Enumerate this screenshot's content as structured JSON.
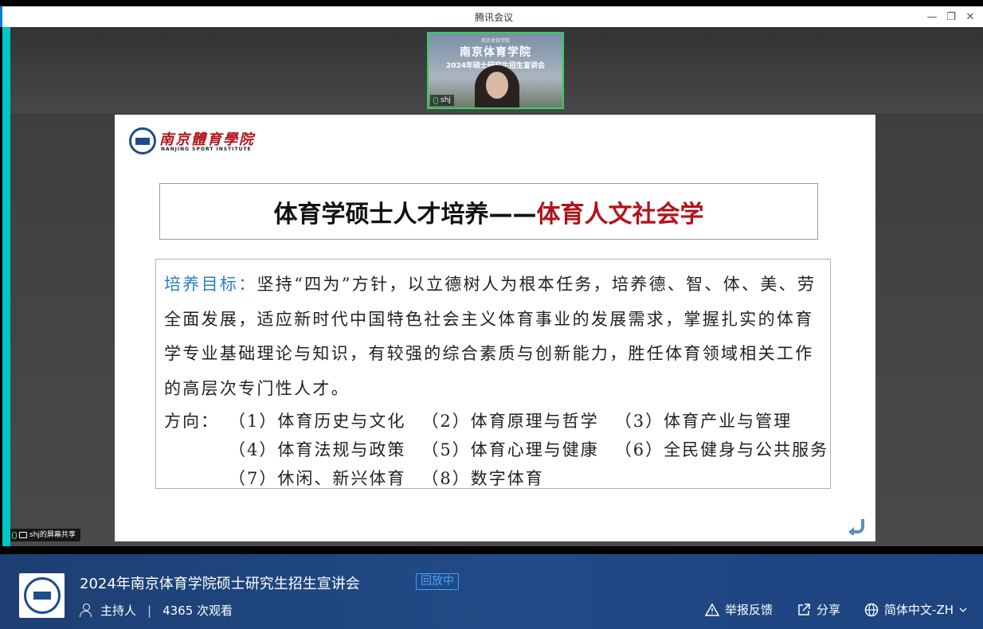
{
  "window": {
    "title": "腾讯会议",
    "controls": {
      "minimize": "—",
      "restore": "❐",
      "close": "✕"
    }
  },
  "video": {
    "banner_small": "南京体育学院",
    "banner_title": "南京体育学院",
    "banner_subtitle": "2024年硕士研究生招生宣讲会",
    "participant_name": "shj"
  },
  "slide": {
    "logo_cn": "南京體育學院",
    "logo_en": "NANJING SPORT INSTITUTE",
    "heading_black": "体育学硕士人才培养——",
    "heading_red": "体育人文社会学",
    "goal_label": "培养目标：",
    "goal_text": "坚持“四为”方针，以立德树人为根本任务，培养德、智、体、美、劳全面发展，适应新时代中国特色社会主义体育事业的发展需求，掌握扎实的体育学专业基础理论与知识，有较强的综合素质与创新能力，胜任体育领域相关工作的高层次专门性人才。",
    "direction_label": "方向：",
    "directions": [
      "（1）体育历史与文化",
      "（2）体育原理与哲学",
      "（3）体育产业与管理",
      "（4）体育法规与政策",
      "（5）体育心理与健康",
      "（6）全民健身与公共服务",
      "（7）休闲、新兴体育",
      "（8）数字体育"
    ]
  },
  "share_badge": "shj的屏幕共享",
  "info": {
    "event_title": "2024年南京体育学院硕士研究生招生宣讲会",
    "status": "回放中",
    "host": "主持人",
    "views": "4365 次观看",
    "report": "举报反馈",
    "share": "分享",
    "language": "简体中文-ZH"
  },
  "colors": {
    "accent_red": "#b0141a",
    "goal_blue": "#2a7fbf",
    "bar_blue": "#214a86",
    "badge_blue": "#4ea3ff",
    "video_border": "#2fd35c"
  }
}
